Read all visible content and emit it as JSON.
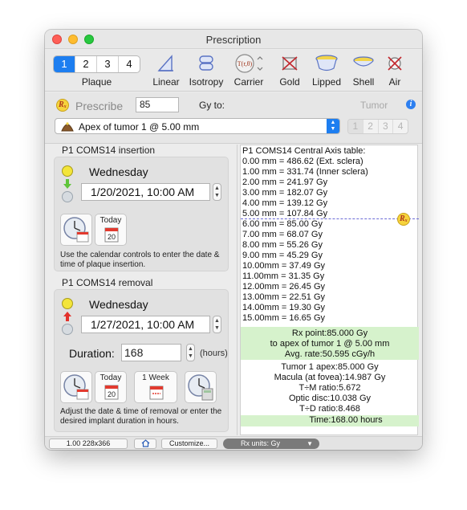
{
  "window": {
    "title": "Prescription"
  },
  "toolbar": {
    "plaque_segments": [
      "1",
      "2",
      "3",
      "4"
    ],
    "plaque_caption": "Plaque",
    "tools": [
      "Linear",
      "Isotropy",
      "Carrier",
      "Gold",
      "Lipped",
      "Shell",
      "Air"
    ],
    "carrier_symbol": "T(r,θ)"
  },
  "prescribe": {
    "label": "Prescribe",
    "dose": "85",
    "gy_to": "Gy to:",
    "tumor_label": "Tumor",
    "info": "i",
    "target": "Apex of tumor 1 @ 5.00 mm",
    "tumor_segments": [
      "1",
      "2",
      "3",
      "4"
    ]
  },
  "insertion": {
    "title": "P1 COMS14 insertion",
    "day": "Wednesday",
    "datetime": "1/20/2021, 10:00 AM",
    "today_label": "Today",
    "today_day": "20",
    "help": "Use the calendar controls to enter the date & time of plaque insertion."
  },
  "removal": {
    "title": "P1 COMS14 removal",
    "day": "Wednesday",
    "datetime": "1/27/2021, 10:00 AM",
    "duration_label": "Duration:",
    "duration": "168",
    "hours": "(hours)",
    "today_label": "Today",
    "today_day": "20",
    "week_label": "1 Week",
    "help": "Adjust the date & time of removal or enter the desired implant duration in hours."
  },
  "central_axis": {
    "title": "P1 COMS14 Central Axis table:",
    "rows": [
      "0.00 mm = 486.62 (Ext. sclera)",
      "1.00 mm = 331.74 (Inner sclera)",
      "2.00 mm = 241.97 Gy",
      "3.00 mm = 182.07 Gy",
      "4.00 mm = 139.12 Gy",
      "5.00 mm = 107.84 Gy",
      "6.00 mm = 85.00 Gy",
      "7.00 mm = 68.07 Gy",
      "8.00 mm = 55.26 Gy",
      "9.00 mm = 45.29 Gy",
      "10.00mm = 37.49 Gy",
      "11.00mm = 31.35 Gy",
      "12.00mm = 26.45 Gy",
      "13.00mm = 22.51 Gy",
      "14.00mm = 19.30 Gy",
      "15.00mm = 16.65 Gy"
    ],
    "rx_point": "Rx point:85.000 Gy",
    "rx_target": "to apex of tumor 1 @ 5.00 mm",
    "avg_rate": "Avg. rate:50.595 cGy/h",
    "tumor_apex": "Tumor 1 apex:85.000 Gy",
    "macula": "Macula (at fovea):14.987 Gy",
    "tm_ratio": "T÷M ratio:5.672",
    "optic_disc": "Optic disc:10.038 Gy",
    "td_ratio": "T÷D ratio:8.468",
    "time": "Time:168.00 hours"
  },
  "statusbar": {
    "version": "1.00 228x366",
    "customize": "Customize...",
    "rx_units": "Rx units: Gy"
  },
  "rx_symbol": "Rₓ",
  "colors": {
    "accent": "#1d7ef0",
    "green_highlight": "#d6f2cc",
    "rx_line": "#6b6bd6"
  }
}
